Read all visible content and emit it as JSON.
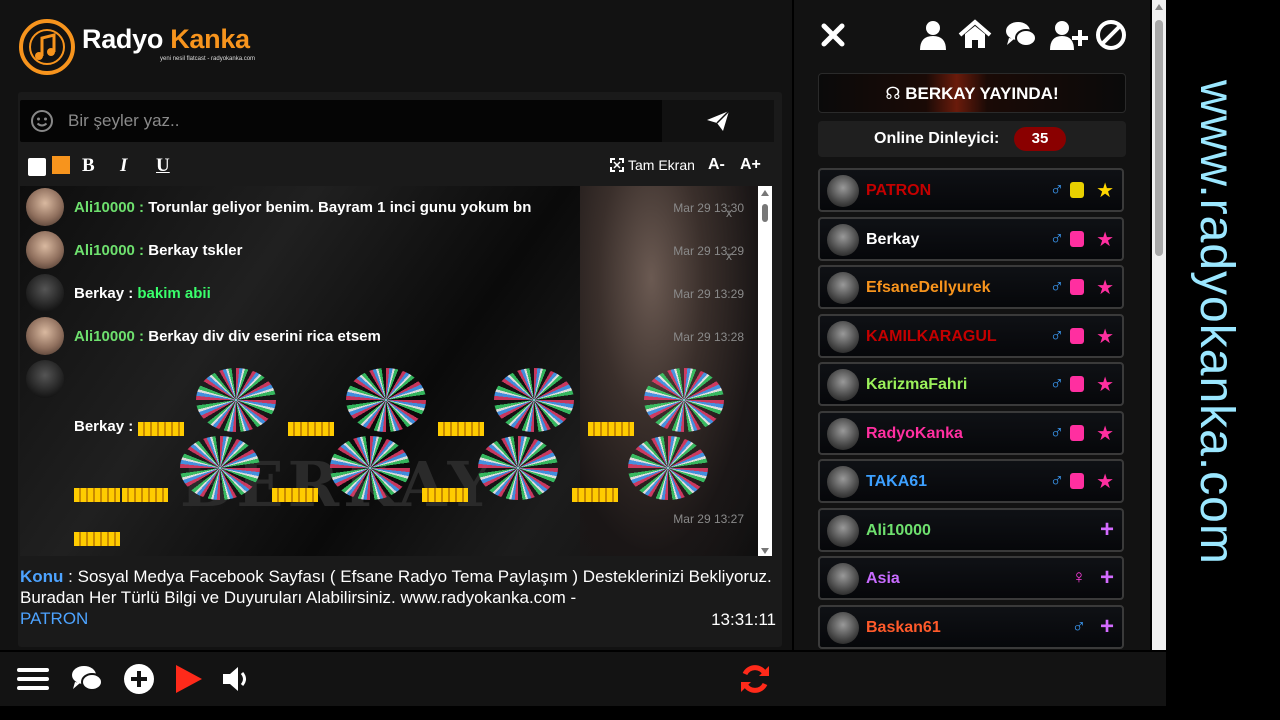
{
  "logo": {
    "brand_word1": "Radyo",
    "brand_word2": "Kanka",
    "slogan": "yeni nesil flatcast - radyokanka.com",
    "accent": "#f7941d"
  },
  "composer": {
    "placeholder": "Bir şeyler yaz..",
    "smile_icon": "smile-icon",
    "send_icon": "paper-plane-icon"
  },
  "format_bar": {
    "bold": "B",
    "italic": "I",
    "underline": "U",
    "fullscreen": "Tam Ekran",
    "font_minus": "A-",
    "font_plus": "A+",
    "swatch_color": "#f7941d"
  },
  "messages": [
    {
      "nick": "Ali10000",
      "text": "Torunlar geliyor benim. Bayram 1 inci gunu yokum bn",
      "time": "Mar 29 13:30"
    },
    {
      "nick": "Ali10000",
      "text": "Berkay tskler",
      "time": "Mar 29 13:29"
    },
    {
      "nick": "Berkay",
      "text": "bakim abii",
      "time": "Mar 29 13:29"
    },
    {
      "nick": "Ali10000",
      "text": "Berkay div div eserini rica etsem",
      "time": "Mar 29 13:28"
    },
    {
      "nick": "Berkay",
      "text": "",
      "time": "Mar 29 13:27"
    }
  ],
  "background_word": "BERKAY",
  "topic": {
    "label": "Konu",
    "text": "Sosyal Medya Facebook Sayfası ( Efsane Radyo Tema Paylaşım ) Desteklerinizi Bekliyoruz. Buradan Her Türlü Bilgi ve Duyuruları Alabilirsiniz. www.radyokanka.com -",
    "by": "PATRON",
    "clock": "13:31:11"
  },
  "right": {
    "onair": "BERKAY YAYINDA!",
    "online_label": "Online Dinleyici:",
    "online_count": "35",
    "users": [
      {
        "name": "PATRON",
        "color": "#c40000",
        "gender": "♂",
        "gclass": "male",
        "badge": "star",
        "badge_color": "#ffd700",
        "lock_color": "#e8d000"
      },
      {
        "name": "Berkay",
        "color": "#ffffff",
        "gender": "♂",
        "gclass": "male",
        "badge": "star",
        "badge_color": "#ff2fa0",
        "lock_color": "#ff2fa0"
      },
      {
        "name": "EfsaneDellyurek",
        "color": "#f7941d",
        "gender": "♂",
        "gclass": "male",
        "badge": "star",
        "badge_color": "#ff2fa0",
        "lock_color": "#ff2fa0"
      },
      {
        "name": "KAMILKARAGUL",
        "color": "#c40000",
        "gender": "♂",
        "gclass": "male",
        "badge": "star",
        "badge_color": "#ff2fa0",
        "lock_color": "#ff2fa0"
      },
      {
        "name": "KarizmaFahri",
        "color": "#9bf05a",
        "gender": "♂",
        "gclass": "male",
        "badge": "star",
        "badge_color": "#ff2fa0",
        "lock_color": "#ff2fa0"
      },
      {
        "name": "RadyoKanka",
        "color": "#ff2fa0",
        "gender": "♂",
        "gclass": "male",
        "badge": "star",
        "badge_color": "#ff2fa0",
        "lock_color": "#ff2fa0"
      },
      {
        "name": "TAKA61",
        "color": "#3da0ff",
        "gender": "♂",
        "gclass": "male",
        "badge": "star",
        "badge_color": "#ff2fa0",
        "lock_color": "#ff2fa0"
      },
      {
        "name": "Ali10000",
        "color": "#6ee06e",
        "gender": "",
        "gclass": "male",
        "badge": "plus",
        "badge_color": "#d36bff",
        "lock_color": ""
      },
      {
        "name": "Asia",
        "color": "#c86bff",
        "gender": "♀",
        "gclass": "female",
        "badge": "plus",
        "badge_color": "#d36bff",
        "lock_color": ""
      },
      {
        "name": "Baskan61",
        "color": "#ff5a2a",
        "gender": "♂",
        "gclass": "male",
        "badge": "plus",
        "badge_color": "#d36bff",
        "lock_color": ""
      }
    ]
  },
  "watermark": "www.radyokanka.com",
  "icons": {
    "top": [
      "close-icon",
      "user-icon",
      "home-icon",
      "comments-icon",
      "add-user-icon",
      "ban-icon"
    ],
    "bottom": [
      "menu-icon",
      "chat-icon",
      "plus-circle-icon",
      "play-icon",
      "volume-icon",
      "refresh-icon"
    ]
  }
}
